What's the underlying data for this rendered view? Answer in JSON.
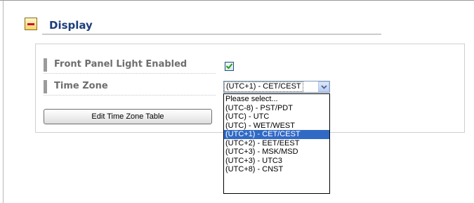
{
  "section": {
    "title": "Display",
    "collapse_icon": "minus-icon"
  },
  "settings": {
    "front_panel_light": {
      "label": "Front Panel Light Enabled",
      "checked": true
    },
    "time_zone": {
      "label": "Time Zone",
      "selected_value": "(UTC+1) - CET/CEST",
      "options": [
        "Please select...",
        "(UTC-8) - PST/PDT",
        "(UTC) - UTC",
        "(UTC) - WET/WEST",
        "(UTC+1) - CET/CEST",
        "(UTC+2) - EET/EEST",
        "(UTC+3) - MSK/MSD",
        "(UTC+3) - UTC3",
        "(UTC+8) - CNST"
      ],
      "highlighted_option": "(UTC+1) - CET/CEST"
    },
    "edit_button_label": "Edit Time Zone Table"
  },
  "colors": {
    "title": "#1d3f7a",
    "label": "#6e6e6e",
    "selection": "#316ac5",
    "collapse_minus": "#c8102e"
  }
}
